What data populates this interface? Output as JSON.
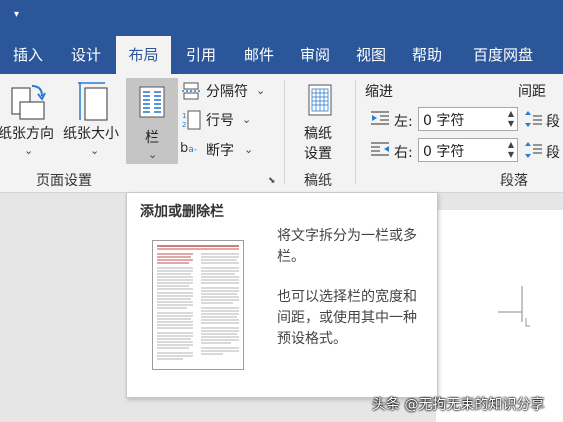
{
  "quick_access": {
    "customize_icon": "chevron-down-icon"
  },
  "tabs": [
    {
      "label": "插入"
    },
    {
      "label": "设计"
    },
    {
      "label": "布局",
      "active": true
    },
    {
      "label": "引用"
    },
    {
      "label": "邮件"
    },
    {
      "label": "审阅"
    },
    {
      "label": "视图"
    },
    {
      "label": "帮助"
    },
    {
      "label": "百度网盘"
    }
  ],
  "ribbon": {
    "page_setup": {
      "orientation": "纸张方向",
      "size": "纸张大小",
      "columns": "栏",
      "breaks": "分隔符",
      "line_numbers": "行号",
      "hyphenation": "断字",
      "group_label": "页面设置",
      "launcher_icon": "dialog-launcher-icon"
    },
    "manuscript": {
      "button_line1": "稿纸",
      "button_line2": "设置",
      "group_label": "稿纸"
    },
    "paragraph": {
      "indent_label": "缩进",
      "spacing_label": "间距",
      "left_label": "左:",
      "right_label": "右:",
      "left_value": "0 字符",
      "right_value": "0 字符",
      "before_label": "段",
      "after_label": "段",
      "group_label": "段落"
    }
  },
  "tooltip": {
    "title": "添加或删除栏",
    "desc_line1": "将文字拆分为一栏或多",
    "desc_line2": "栏。",
    "desc_line3": "也可以选择栏的宽度和",
    "desc_line4": "间距，或使用其中一种",
    "desc_line5": "预设格式。"
  },
  "watermark": "头条 @无拘无束的知识分享",
  "colors": {
    "ribbon_accent": "#2b579a",
    "ribbon_bg": "#f3f3f3",
    "selected": "#c5c5c5"
  }
}
